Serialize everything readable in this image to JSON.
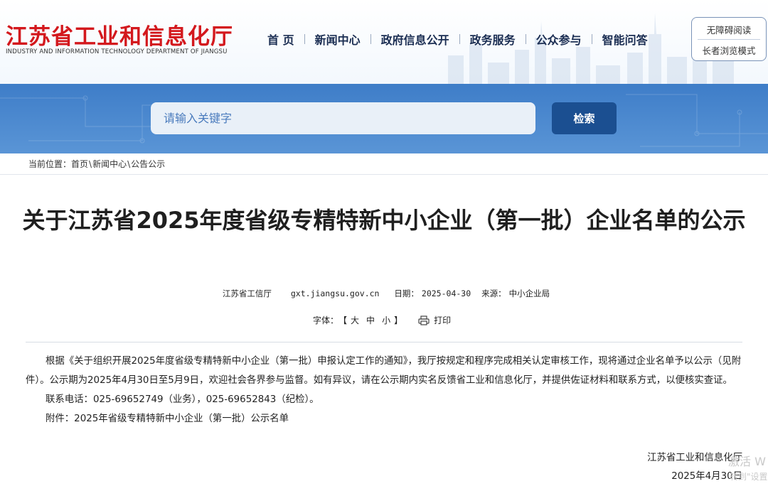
{
  "header": {
    "site_title": "江苏省工业和信息化厅",
    "site_subtitle": "INDUSTRY AND INFORMATION TECHNOLOGY DEPARTMENT OF JIANGSU",
    "nav": [
      {
        "label": "首 页"
      },
      {
        "label": "新闻中心"
      },
      {
        "label": "政府信息公开"
      },
      {
        "label": "政务服务"
      },
      {
        "label": "公众参与"
      },
      {
        "label": "智能问答"
      }
    ],
    "accessibility": {
      "barrier_free": "无障碍阅读",
      "elder_mode": "长者浏览模式"
    }
  },
  "search": {
    "placeholder": "请输入关键字",
    "button_label": "检索"
  },
  "breadcrumb": {
    "prefix": "当前位置：",
    "items": [
      "首页",
      "新闻中心",
      "公告公示"
    ],
    "separator": "\\"
  },
  "article": {
    "title": "关于江苏省2025年度省级专精特新中小企业（第一批）企业名单的公示",
    "meta": {
      "publisher": "江苏省工信厅",
      "domain": "gxt.jiangsu.gov.cn",
      "date_label": "日期：",
      "date": "2025-04-30",
      "source_label": "来源：",
      "source": "中小企业局"
    },
    "tools": {
      "font_label": "字体：",
      "bracket_open": "【",
      "font_large": "大",
      "font_medium": "中",
      "font_small": "小",
      "bracket_close": "】",
      "print_label": "打印"
    },
    "paragraphs": [
      "根据《关于组织开展2025年度省级专精特新中小企业（第一批）申报认定工作的通知》，我厅按规定和程序完成相关认定审核工作，现将通过企业名单予以公示（见附件）。公示期为2025年4月30日至5月9日，欢迎社会各界参与监督。如有异议，请在公示期内实名反馈省工业和信息化厅，并提供佐证材料和联系方式，以便核实查证。",
      "联系电话：025-69652749（业务），025-69652843（纪检）。",
      "附件：2025年省级专精特新中小企业（第一批）公示名单"
    ],
    "signature": {
      "org": "江苏省工业和信息化厅",
      "date": "2025年4月30日"
    }
  },
  "overlay": {
    "watermark_line1": "激活 W",
    "watermark_line2": "转到\"设置"
  }
}
